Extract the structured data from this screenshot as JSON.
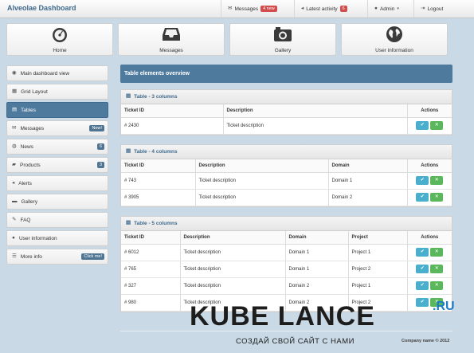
{
  "app": {
    "title": "Alveolae Dashboard"
  },
  "topnav": [
    {
      "label": "Messages",
      "badge": "4 new",
      "icon": "comment-icon"
    },
    {
      "label": "Latest activity",
      "badge": "6",
      "icon": "megaphone-icon"
    },
    {
      "label": "Admin",
      "icon": "user-icon"
    },
    {
      "label": "Logout",
      "icon": "logout-icon"
    }
  ],
  "quick": [
    {
      "label": "Home",
      "icon": "speedometer-icon"
    },
    {
      "label": "Messages",
      "icon": "inbox-icon"
    },
    {
      "label": "Gallery",
      "icon": "camera-icon"
    },
    {
      "label": "User information",
      "icon": "globe-icon"
    }
  ],
  "sidebar": {
    "items": [
      {
        "label": "Main dashboard view",
        "icon": "dashboard-icon"
      },
      {
        "label": "Grid Layout",
        "icon": "grid-icon"
      },
      {
        "label": "Tables",
        "icon": "table-icon",
        "active": true
      },
      {
        "label": "Messages",
        "icon": "comment-icon",
        "badge": "New!"
      },
      {
        "label": "News",
        "icon": "globe-icon",
        "badge": "6"
      },
      {
        "label": "Products",
        "icon": "truck-icon",
        "badge": "3"
      },
      {
        "label": "Alerts",
        "icon": "bullhorn-icon"
      },
      {
        "label": "Gallery",
        "icon": "folder-icon"
      },
      {
        "label": "FAQ",
        "icon": "wrench-icon"
      },
      {
        "label": "User information",
        "icon": "user-icon"
      },
      {
        "label": "More info",
        "icon": "list-icon",
        "badge": "Click me!"
      }
    ]
  },
  "page": {
    "title": "Table elements overview"
  },
  "tables": [
    {
      "title": "Table - 3 columns",
      "headers": [
        "Ticket ID",
        "Description",
        "Actions"
      ],
      "rows": [
        [
          "# 2430",
          "Ticket description"
        ]
      ]
    },
    {
      "title": "Table - 4 columns",
      "headers": [
        "Ticket ID",
        "Description",
        "Domain",
        "Actions"
      ],
      "rows": [
        [
          "# 743",
          "Ticket description",
          "Domain 1"
        ],
        [
          "# 3905",
          "Ticket description",
          "Domain 2"
        ]
      ]
    },
    {
      "title": "Table - 5 columns",
      "headers": [
        "Ticket ID",
        "Description",
        "Domain",
        "Project",
        "Actions"
      ],
      "rows": [
        [
          "# 6012",
          "Ticket description",
          "Domain 1",
          "Project 1"
        ],
        [
          "# 765",
          "Ticket description",
          "Domain 1",
          "Project 2"
        ],
        [
          "# 327",
          "Ticket description",
          "Domain 2",
          "Project 1"
        ],
        [
          "# 980",
          "Ticket description",
          "Domain 2",
          "Project 2"
        ]
      ]
    }
  ],
  "actions": {
    "ok": "✔",
    "remove": "✕"
  },
  "footer": {
    "copyright": "Company name © 2012"
  },
  "watermark": {
    "brand": "KUBE LANCE",
    "tld": ".RU",
    "tagline": "СОЗДАЙ СВОЙ САЙТ С НАМИ"
  },
  "colors": {
    "accent": "#4e7a9e",
    "badge_red": "#d34c4c",
    "btn_ok": "#49afcd",
    "btn_remove": "#5bb75b"
  }
}
